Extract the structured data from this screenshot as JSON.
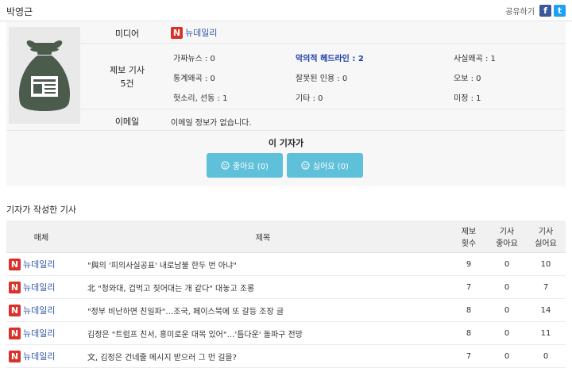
{
  "reporter": {
    "name": "박영근"
  },
  "share": {
    "label": "공유하기",
    "facebook_glyph": "f",
    "twitter_glyph": "t"
  },
  "info": {
    "media_label": "미디어",
    "media_logo": "N",
    "media_name": "뉴데일리",
    "report_label_1": "제보 기사",
    "report_label_2": "5건",
    "categories": [
      {
        "label": "가짜뉴스 : 0"
      },
      {
        "label": "악의적 헤드라인 : 2"
      },
      {
        "label": "사실왜곡 : 1"
      },
      {
        "label": "통계왜곡 : 0"
      },
      {
        "label": "잘못된 인용 : 0"
      },
      {
        "label": "오보 : 0"
      },
      {
        "label": "헛소리, 선동 : 1"
      },
      {
        "label": "기타 : 0"
      },
      {
        "label": "미정 : 1"
      }
    ],
    "email_label": "이메일",
    "email_value": "이메일 정보가 없습니다."
  },
  "vote": {
    "title": "이 기자가",
    "like_label": "좋아요 (0)",
    "dislike_label": "싫어요 (0)"
  },
  "articles_section": {
    "title": "기자가 작성한 기사",
    "headers": {
      "media": "매체",
      "title": "제목",
      "reports_1": "제보",
      "reports_2": "횟수",
      "likes_1": "기사",
      "likes_2": "좋아요",
      "dislikes_1": "기사",
      "dislikes_2": "싫어요"
    },
    "rows": [
      {
        "outlet": "뉴데일리",
        "title": "\"與의 '피의사실공표' 내로남불 한두 번 아냐\"",
        "reports": "9",
        "likes": "0",
        "dislikes": "10"
      },
      {
        "outlet": "뉴데일리",
        "title": "北 \"청와대, 겁먹고 짖어대는 개 같다\" 대놓고 조롱",
        "reports": "7",
        "likes": "0",
        "dislikes": "7"
      },
      {
        "outlet": "뉴데일리",
        "title": "\"정부 비난하면 친일파\"…조국, 페이스북에 또 갈등 조장 글",
        "reports": "8",
        "likes": "0",
        "dislikes": "14"
      },
      {
        "outlet": "뉴데일리",
        "title": "김정은 \"트럼프 친서, 흥미로운 대목 있어\"…'틈다운' 돌파구 전망",
        "reports": "8",
        "likes": "0",
        "dislikes": "11"
      },
      {
        "outlet": "뉴데일리",
        "title": "文, 김정은 건네줄 메시지 받으러 그 먼 길을?",
        "reports": "7",
        "likes": "0",
        "dislikes": "0"
      }
    ]
  },
  "colors": {
    "accent": "#5fc0da",
    "logo": "#d9322b",
    "facebook": "#3b5998",
    "twitter": "#1da1f2",
    "link": "#2f57a3"
  }
}
